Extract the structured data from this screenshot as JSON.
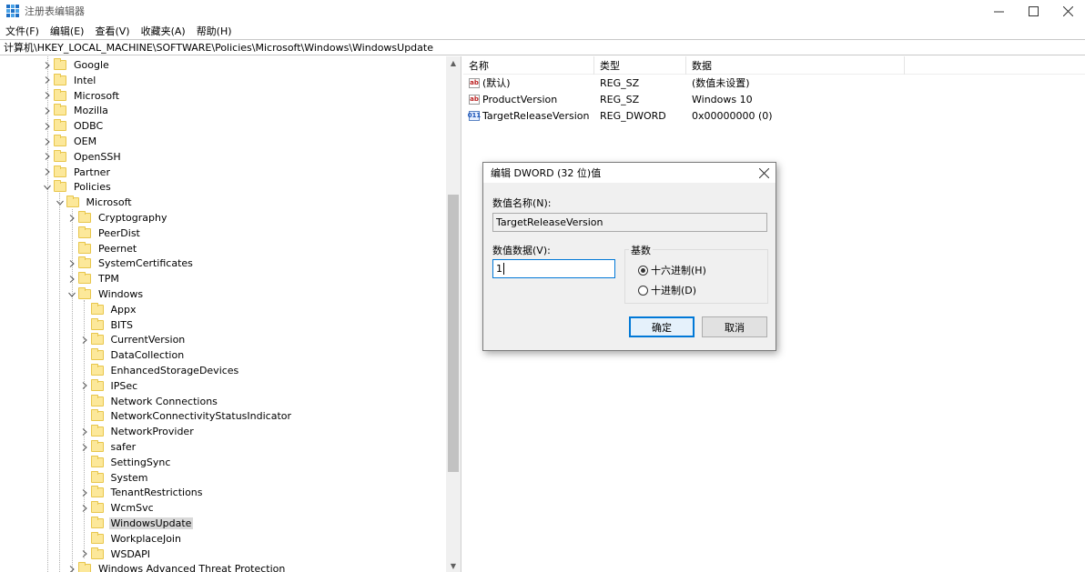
{
  "window": {
    "title": "注册表编辑器"
  },
  "menu": [
    "文件(F)",
    "编辑(E)",
    "查看(V)",
    "收藏夹(A)",
    "帮助(H)"
  ],
  "address": "计算机\\HKEY_LOCAL_MACHINE\\SOFTWARE\\Policies\\Microsoft\\Windows\\WindowsUpdate",
  "tree": [
    {
      "label": "Google",
      "level": 0,
      "expander": "collapsed"
    },
    {
      "label": "Intel",
      "level": 0,
      "expander": "collapsed"
    },
    {
      "label": "Microsoft",
      "level": 0,
      "expander": "collapsed"
    },
    {
      "label": "Mozilla",
      "level": 0,
      "expander": "collapsed"
    },
    {
      "label": "ODBC",
      "level": 0,
      "expander": "collapsed"
    },
    {
      "label": "OEM",
      "level": 0,
      "expander": "collapsed"
    },
    {
      "label": "OpenSSH",
      "level": 0,
      "expander": "collapsed"
    },
    {
      "label": "Partner",
      "level": 0,
      "expander": "collapsed"
    },
    {
      "label": "Policies",
      "level": 0,
      "expander": "expanded"
    },
    {
      "label": "Microsoft",
      "level": 1,
      "expander": "expanded"
    },
    {
      "label": "Cryptography",
      "level": 2,
      "expander": "collapsed"
    },
    {
      "label": "PeerDist",
      "level": 2,
      "expander": "none"
    },
    {
      "label": "Peernet",
      "level": 2,
      "expander": "none"
    },
    {
      "label": "SystemCertificates",
      "level": 2,
      "expander": "collapsed"
    },
    {
      "label": "TPM",
      "level": 2,
      "expander": "collapsed"
    },
    {
      "label": "Windows",
      "level": 2,
      "expander": "expanded"
    },
    {
      "label": "Appx",
      "level": 3,
      "expander": "none"
    },
    {
      "label": "BITS",
      "level": 3,
      "expander": "none"
    },
    {
      "label": "CurrentVersion",
      "level": 3,
      "expander": "collapsed"
    },
    {
      "label": "DataCollection",
      "level": 3,
      "expander": "none"
    },
    {
      "label": "EnhancedStorageDevices",
      "level": 3,
      "expander": "none"
    },
    {
      "label": "IPSec",
      "level": 3,
      "expander": "collapsed"
    },
    {
      "label": "Network Connections",
      "level": 3,
      "expander": "none"
    },
    {
      "label": "NetworkConnectivityStatusIndicator",
      "level": 3,
      "expander": "none"
    },
    {
      "label": "NetworkProvider",
      "level": 3,
      "expander": "collapsed"
    },
    {
      "label": "safer",
      "level": 3,
      "expander": "collapsed"
    },
    {
      "label": "SettingSync",
      "level": 3,
      "expander": "none"
    },
    {
      "label": "System",
      "level": 3,
      "expander": "none"
    },
    {
      "label": "TenantRestrictions",
      "level": 3,
      "expander": "collapsed"
    },
    {
      "label": "WcmSvc",
      "level": 3,
      "expander": "collapsed"
    },
    {
      "label": "WindowsUpdate",
      "level": 3,
      "expander": "none",
      "selected": true
    },
    {
      "label": "WorkplaceJoin",
      "level": 3,
      "expander": "none"
    },
    {
      "label": "WSDAPI",
      "level": 3,
      "expander": "collapsed"
    },
    {
      "label": "Windows Advanced Threat Protection",
      "level": 2,
      "expander": "collapsed"
    }
  ],
  "values": {
    "headers": [
      "名称",
      "类型",
      "数据"
    ],
    "rows": [
      {
        "icon": "ab",
        "name": "(默认)",
        "type": "REG_SZ",
        "data": "(数值未设置)"
      },
      {
        "icon": "ab",
        "name": "ProductVersion",
        "type": "REG_SZ",
        "data": "Windows 10"
      },
      {
        "icon": "dword",
        "name": "TargetReleaseVersion",
        "type": "REG_DWORD",
        "data": "0x00000000 (0)"
      }
    ]
  },
  "dialog": {
    "title": "编辑 DWORD (32 位)值",
    "name_label": "数值名称(N):",
    "name_value": "TargetReleaseVersion",
    "data_label": "数值数据(V):",
    "data_value": "1",
    "base_label": "基数",
    "radio_hex": "十六进制(H)",
    "radio_dec": "十进制(D)",
    "selected_base": "hex",
    "ok": "确定",
    "cancel": "取消"
  }
}
